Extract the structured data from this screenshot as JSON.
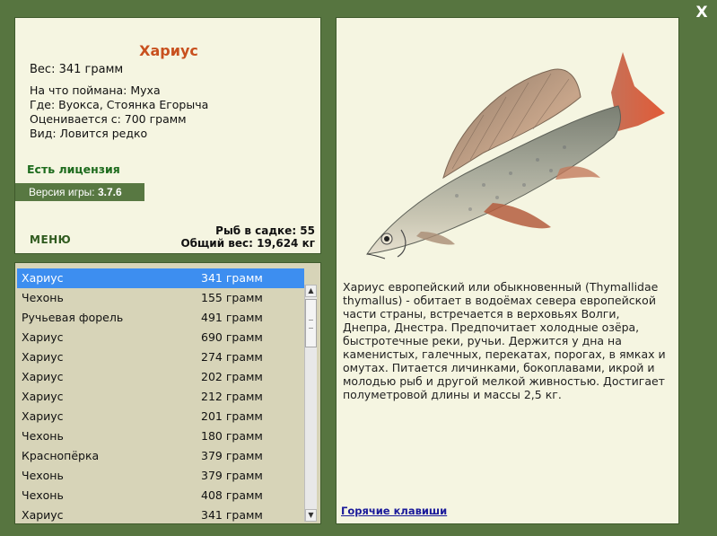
{
  "window": {
    "close_label": "X"
  },
  "fish_info": {
    "title": "Хариус",
    "weight": "Вес: 341 грамм",
    "caught_with": "На что поймана: Муха",
    "location": "Где: Вуокса, Стоянка Егорыча",
    "value": "Оценивается с: 700 грамм",
    "rarity": "Вид: Ловится редко"
  },
  "license": "Есть лицензия",
  "version": {
    "label": "Версия игры:",
    "number": "3.7.6"
  },
  "menu_label": "МЕНЮ",
  "stats": {
    "fish_count": "Рыб в садке: 55",
    "total_weight": "Общий вес: 19,624 кг"
  },
  "catch_list": [
    {
      "name": "Хариус",
      "weight": "341 грамм",
      "selected": true
    },
    {
      "name": "Чехонь",
      "weight": "155 грамм"
    },
    {
      "name": "Ручьевая форель",
      "weight": "491 грамм"
    },
    {
      "name": "Хариус",
      "weight": "690 грамм"
    },
    {
      "name": "Хариус",
      "weight": "274 грамм"
    },
    {
      "name": "Хариус",
      "weight": "202 грамм"
    },
    {
      "name": "Хариус",
      "weight": "212 грамм"
    },
    {
      "name": "Хариус",
      "weight": "201 грамм"
    },
    {
      "name": "Чехонь",
      "weight": "180 грамм"
    },
    {
      "name": "Краснопёрка",
      "weight": "379 грамм"
    },
    {
      "name": "Чехонь",
      "weight": "379 грамм"
    },
    {
      "name": "Чехонь",
      "weight": "408 грамм"
    },
    {
      "name": "Хариус",
      "weight": "341 грамм"
    }
  ],
  "scrollbar": {
    "up_arrow": "▲",
    "down_arrow": "▼"
  },
  "description": "Хариус европейский или обыкновенный (Thymallidae thymallus) - обитает в водоёмах севера европейской части страны, встречается в верховьях Волги, Днепра, Днестра. Предпочитает холодные озёра, быстротечные реки, ручьи. Держится у дна на каменистых, галечных, перекатах, порогах, в ямках и омутах. Питается личинками, бокоплавами, икрой и молодью рыб и другой мелкой живностью. Достигает полуметровой длины и массы 2,5 кг.",
  "hotkeys_label": "Горячие клавиши",
  "colors": {
    "background": "#577540",
    "panel": "#f5f5e1",
    "list_bg": "#d7d4b8",
    "title": "#c8501e",
    "license": "#1d6b1d",
    "selection": "#3d8ef0",
    "link": "#1a1a9a"
  }
}
